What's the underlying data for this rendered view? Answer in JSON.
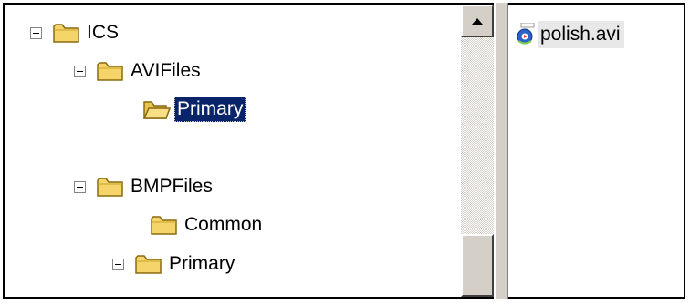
{
  "tree": {
    "nodes": [
      {
        "label": "ICS",
        "expanded": true
      },
      {
        "label": "AVIFiles",
        "expanded": true
      },
      {
        "label": "Primary",
        "selected": true
      },
      {
        "label": "BMPFiles",
        "expanded": true
      },
      {
        "label": "Common"
      },
      {
        "label": "Primary",
        "expanded": true
      }
    ]
  },
  "file_list": {
    "items": [
      {
        "label": "polish.avi"
      }
    ]
  },
  "colors": {
    "selection": "#0a246a",
    "folder_fill": "#f5d46a",
    "chrome": "#d4d0c8"
  }
}
